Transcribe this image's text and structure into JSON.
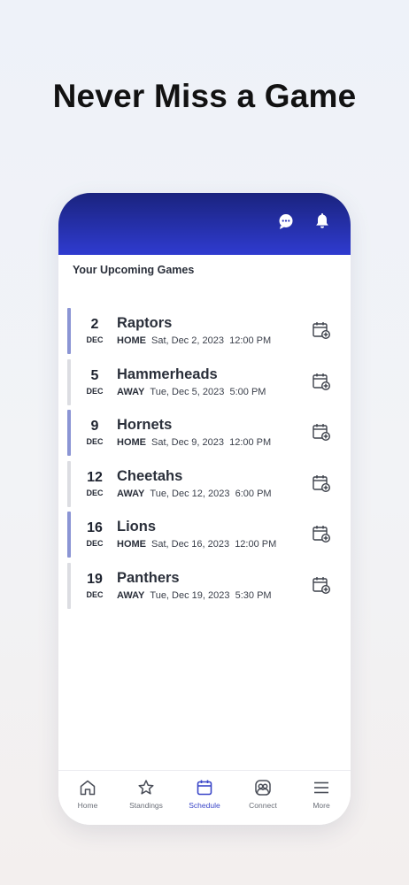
{
  "headline": "Never Miss a Game",
  "section_title": "Your Upcoming Games",
  "colors": {
    "accent": "#3a46c8",
    "home_bar": "#8b95d4",
    "away_bar": "#dcdde2",
    "header_top": "#1a237e",
    "header_bottom": "#2f3bd0"
  },
  "header_icons": [
    "chat-icon",
    "bell-icon"
  ],
  "games": [
    {
      "day": "2",
      "month": "DEC",
      "team": "Raptors",
      "venue": "HOME",
      "date": "Sat, Dec 2, 2023",
      "time": "12:00 PM"
    },
    {
      "day": "5",
      "month": "DEC",
      "team": "Hammerheads",
      "venue": "AWAY",
      "date": "Tue, Dec 5, 2023",
      "time": "5:00 PM"
    },
    {
      "day": "9",
      "month": "DEC",
      "team": "Hornets",
      "venue": "HOME",
      "date": "Sat, Dec 9, 2023",
      "time": "12:00 PM"
    },
    {
      "day": "12",
      "month": "DEC",
      "team": "Cheetahs",
      "venue": "AWAY",
      "date": "Tue, Dec 12, 2023",
      "time": "6:00 PM"
    },
    {
      "day": "16",
      "month": "DEC",
      "team": "Lions",
      "venue": "HOME",
      "date": "Sat, Dec 16, 2023",
      "time": "12:00 PM"
    },
    {
      "day": "19",
      "month": "DEC",
      "team": "Panthers",
      "venue": "AWAY",
      "date": "Tue, Dec 19, 2023",
      "time": "5:30 PM"
    }
  ],
  "tabs": [
    {
      "label": "Home",
      "icon": "home-icon"
    },
    {
      "label": "Standings",
      "icon": "star-icon"
    },
    {
      "label": "Schedule",
      "icon": "calendar-icon",
      "active": true
    },
    {
      "label": "Connect",
      "icon": "people-icon"
    },
    {
      "label": "More",
      "icon": "menu-icon"
    }
  ]
}
